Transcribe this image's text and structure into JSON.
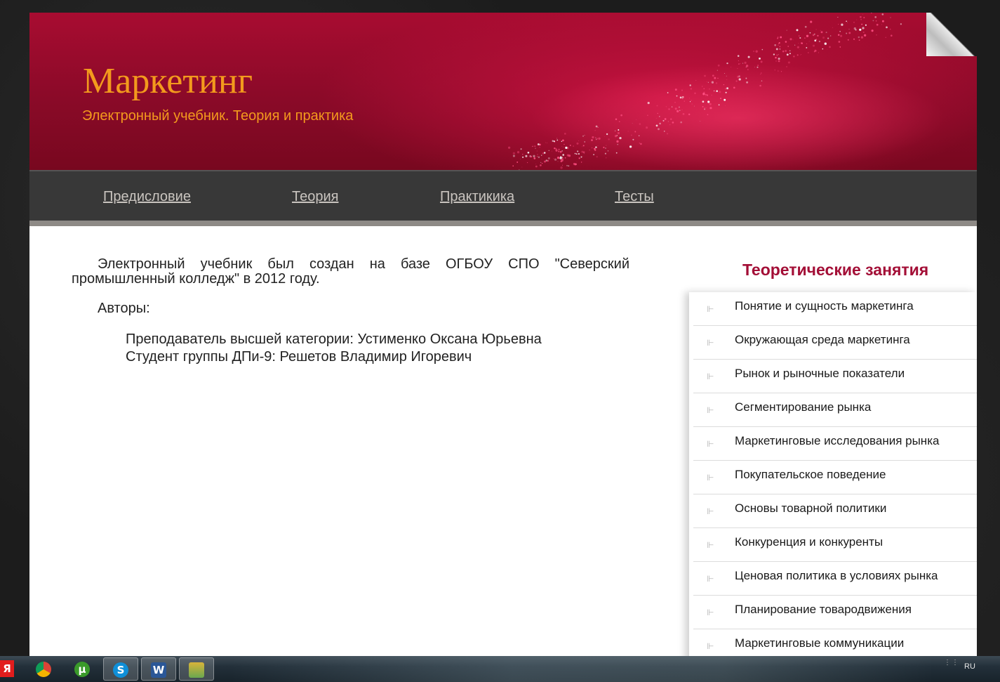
{
  "header": {
    "title": "Маркетинг",
    "subtitle": "Электронный учебник. Теория и практика"
  },
  "nav": {
    "items": [
      {
        "label": "Предисловие"
      },
      {
        "label": "Теория"
      },
      {
        "label": "Практикика"
      },
      {
        "label": "Тесты"
      }
    ]
  },
  "main": {
    "intro": "Электронный учебник был создан на базе ОГБОУ СПО \"Северский промышленный колледж\" в 2012 году.",
    "authors_label": "Авторы:",
    "authors": [
      "Преподаватель высшей категории: Устименко Оксана Юрьевна",
      "Студент группы ДПи-9: Решетов Владимир Игоревич"
    ]
  },
  "sidebar": {
    "title": "Теоретические занятия",
    "items": [
      {
        "label": "Понятие и сущность маркетинга"
      },
      {
        "label": "Окружающая среда маркетинга"
      },
      {
        "label": "Рынок и рыночные показатели"
      },
      {
        "label": "Сегментирование рынка"
      },
      {
        "label": "Маркетинговые исследования рынка"
      },
      {
        "label": "Покупательское поведение"
      },
      {
        "label": "Основы товарной политики"
      },
      {
        "label": "Конкуренция и конкуренты"
      },
      {
        "label": "Ценовая политика в условиях рынка"
      },
      {
        "label": "Планирование товародвижения"
      },
      {
        "label": "Маркетинговые коммуникации"
      }
    ]
  },
  "taskbar": {
    "lang": "RU",
    "apps": [
      {
        "icon": "yandex-icon",
        "glyph": "Я",
        "color": "#e21d1d"
      },
      {
        "icon": "chrome-icon",
        "glyph": "",
        "color": "#4caf50"
      },
      {
        "icon": "utorrent-icon",
        "glyph": "µ",
        "color": "#3a9a2a"
      },
      {
        "icon": "skype-icon",
        "glyph": "S",
        "color": "#0f8fd8"
      },
      {
        "icon": "word-icon",
        "glyph": "W",
        "color": "#2b5797"
      },
      {
        "icon": "sheets-icon",
        "glyph": "",
        "color": "#d9b43a"
      }
    ]
  },
  "colors": {
    "header_bg": "#8a0a28",
    "brand_accent": "#f39a1d",
    "nav_bg": "#383838",
    "sidebar_title": "#a30e36"
  }
}
